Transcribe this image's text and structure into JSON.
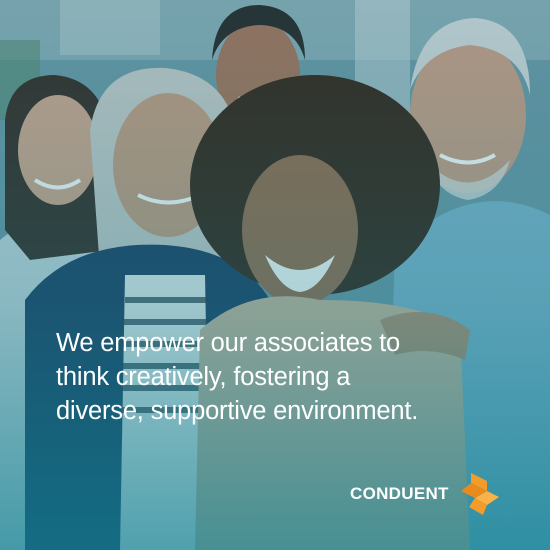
{
  "post": {
    "headline": "We empower our associates to\nthink creatively, fostering a\ndiverse, supportive environment."
  },
  "brand": {
    "name": "CONDUENT",
    "logo_icon": "conduent-logo-icon",
    "logo_color": "#f39c2a"
  },
  "colors": {
    "overlay_teal": "#16879a",
    "text": "#ffffff"
  }
}
